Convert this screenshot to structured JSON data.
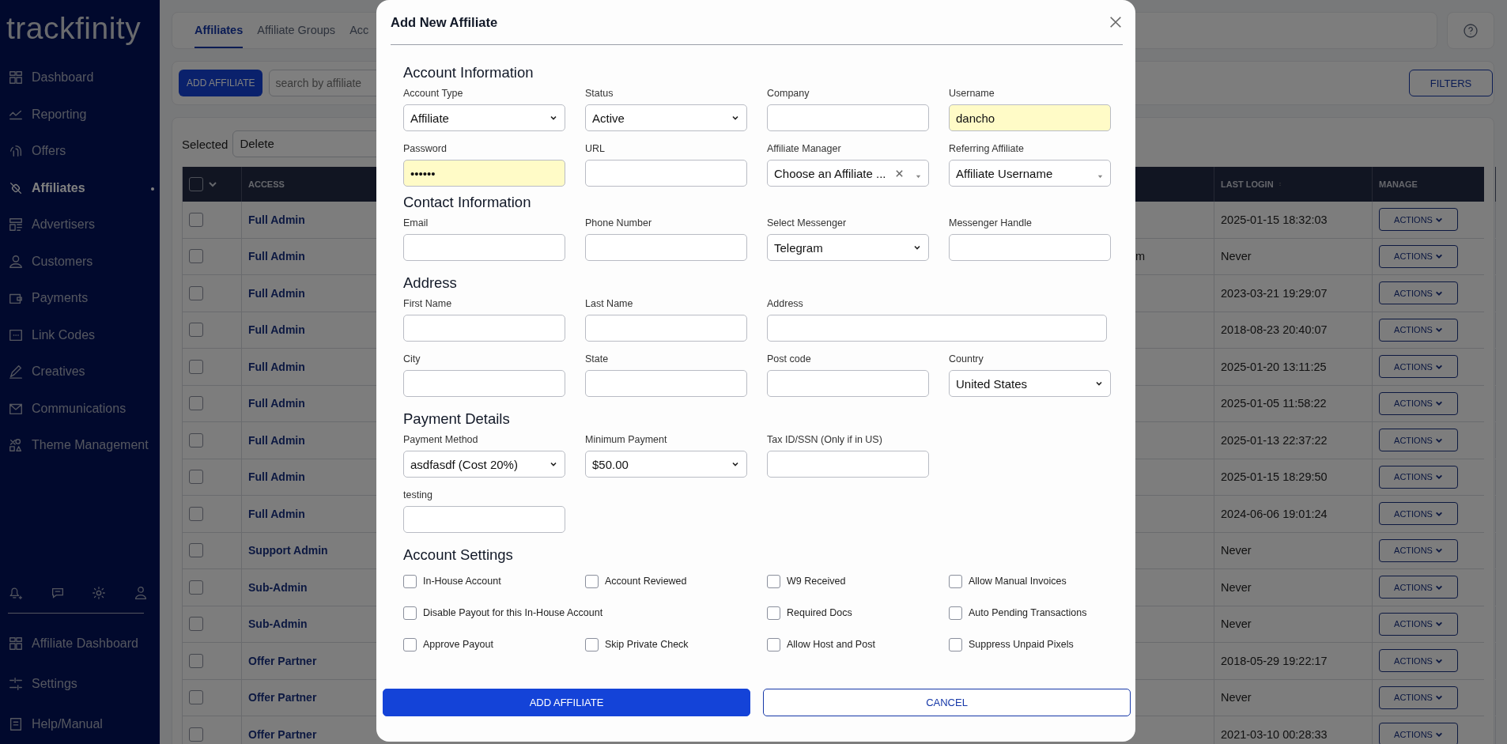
{
  "sidebar": {
    "logo": "trackfinity",
    "items": [
      {
        "label": "Dashboard",
        "selected": false
      },
      {
        "label": "Reporting",
        "selected": false
      },
      {
        "label": "Offers",
        "selected": false
      },
      {
        "label": "Affiliates",
        "selected": true
      },
      {
        "label": "Advertisers",
        "selected": false
      },
      {
        "label": "Customers",
        "selected": false
      },
      {
        "label": "Payments",
        "selected": false
      },
      {
        "label": "Link Codes",
        "selected": false
      },
      {
        "label": "Creatives",
        "selected": false
      },
      {
        "label": "Communications",
        "selected": false
      },
      {
        "label": "Theme Management",
        "selected": false
      }
    ],
    "bottom_items": [
      {
        "label": "Affiliate Dashboard"
      },
      {
        "label": "Settings"
      },
      {
        "label": "Help/Manual"
      }
    ]
  },
  "tabs": [
    {
      "label": "Affiliates",
      "selected": true
    },
    {
      "label": "Affiliate Groups",
      "selected": false
    },
    {
      "label": "Acc",
      "selected": false
    }
  ],
  "toolbar": {
    "add_button": "ADD AFFILIATE",
    "search": {
      "placeholder": "search by affiliate"
    },
    "filters_button": "FILTERS"
  },
  "bulk": {
    "label": "Selected",
    "action": "Delete"
  },
  "table": {
    "columns": [
      "ACCESS",
      "LAST LOGIN",
      "MANAGE"
    ],
    "all_checked": false,
    "rows": [
      {
        "checked": false,
        "access": "Full Admin",
        "last_login": "2025-01-15 18:32:03",
        "action": "ACTIONS"
      },
      {
        "checked": false,
        "access": "Full Admin",
        "column_3": "m",
        "last_login": "Never",
        "action": "ACTIONS"
      },
      {
        "checked": false,
        "access": "Full Admin",
        "last_login": "2023-03-21 19:29:07",
        "action": "ACTIONS"
      },
      {
        "checked": false,
        "access": "Full Admin",
        "last_login": "2018-08-23 20:40:07",
        "action": "ACTIONS"
      },
      {
        "checked": false,
        "access": "Full Admin",
        "last_login": "2025-01-20 13:11:25",
        "action": "ACTIONS"
      },
      {
        "checked": false,
        "access": "Full Admin",
        "last_login": "2025-01-05 11:58:22",
        "action": "ACTIONS"
      },
      {
        "checked": false,
        "access": "Full Admin",
        "last_login": "2025-01-13 22:37:22",
        "action": "ACTIONS"
      },
      {
        "checked": false,
        "access": "Full Admin",
        "last_login": "2025-01-15 18:29:50",
        "action": "ACTIONS"
      },
      {
        "checked": false,
        "access": "Full Admin",
        "last_login": "2024-06-06 19:01:24",
        "action": "ACTIONS"
      },
      {
        "checked": false,
        "access": "Support Admin",
        "last_login": "Never",
        "action": "ACTIONS"
      },
      {
        "checked": false,
        "access": "Sub-Admin",
        "last_login": "Never",
        "action": "ACTIONS"
      },
      {
        "checked": false,
        "access": "Sub-Admin",
        "last_login": "Never",
        "action": "ACTIONS"
      },
      {
        "checked": false,
        "access": "Offer Partner",
        "last_login": "2018-05-29 19:22:17",
        "action": "ACTIONS"
      },
      {
        "checked": false,
        "access": "Offer Partner",
        "last_login": "Never",
        "action": "ACTIONS"
      },
      {
        "checked": false,
        "access": "Offer Partner",
        "last_login": "2021-03-10 00:28:33",
        "action": "ACTIONS"
      }
    ]
  },
  "modal": {
    "title": "Add New Affiliate",
    "sections": [
      {
        "title": "Account Information",
        "rows": [
          [
            {
              "label": "Account Type",
              "kind": "select",
              "value": "Affiliate"
            },
            {
              "label": "Status",
              "kind": "select",
              "value": "Active"
            },
            {
              "label": "Company",
              "kind": "text"
            },
            {
              "label": "Username",
              "kind": "text",
              "value": "dancho",
              "autofilled": true
            }
          ],
          [
            {
              "label": "Password",
              "kind": "text",
              "value": "••••••",
              "autofilled": true
            },
            {
              "label": "URL",
              "kind": "text"
            },
            {
              "label": "Affiliate Manager",
              "kind": "combo",
              "value": "Choose an Affiliate ...",
              "clearable": true
            },
            {
              "label": "Referring Affiliate",
              "kind": "combo",
              "value": "Affiliate Username"
            }
          ]
        ]
      },
      {
        "title": "Contact Information",
        "rows": [
          [
            {
              "label": "Email",
              "kind": "text"
            },
            {
              "label": "Phone Number",
              "kind": "text"
            },
            {
              "label": "Select Messenger",
              "kind": "select",
              "value": "Telegram"
            },
            {
              "label": "Messenger Handle",
              "kind": "text"
            }
          ]
        ]
      },
      {
        "title": "Address",
        "rows": [
          [
            {
              "label": "First Name",
              "kind": "text"
            },
            {
              "label": "Last Name",
              "kind": "text"
            },
            {
              "label": "Address",
              "kind": "text",
              "wide": true
            }
          ],
          [
            {
              "label": "City",
              "kind": "text"
            },
            {
              "label": "State",
              "kind": "text"
            },
            {
              "label": "Post code",
              "kind": "text"
            },
            {
              "label": "Country",
              "kind": "select",
              "value": "United States"
            }
          ]
        ]
      },
      {
        "title": "Payment Details",
        "rows": [
          [
            {
              "label": "Payment Method",
              "kind": "select",
              "value": "asdfasdf (Cost 20%)"
            },
            {
              "label": "Minimum Payment",
              "kind": "select",
              "value": "$50.00"
            },
            {
              "label": "Tax ID/SSN (Only if in US)",
              "kind": "text"
            }
          ],
          [
            {
              "label": "testing",
              "kind": "text"
            }
          ]
        ]
      }
    ],
    "settings_title": "Account Settings",
    "checkboxes": [
      {
        "label": "In-House Account",
        "checked": false
      },
      {
        "label": "Account Reviewed",
        "checked": false
      },
      {
        "label": "W9 Received",
        "checked": false
      },
      {
        "label": "Allow Manual Invoices",
        "checked": false
      },
      {
        "label": "Disable Payout for this In-House Account",
        "checked": false,
        "wide": true
      },
      {
        "label": "Required Docs",
        "checked": false
      },
      {
        "label": "Auto Pending Transactions",
        "checked": false
      },
      {
        "label": "Approve Payout",
        "checked": false
      },
      {
        "label": "Skip Private Check",
        "checked": false
      },
      {
        "label": "Allow Host and Post",
        "checked": false
      },
      {
        "label": "Suppress Unpaid Pixels",
        "checked": false
      }
    ],
    "submit_button": "ADD AFFILIATE",
    "cancel_button": "CANCEL"
  }
}
